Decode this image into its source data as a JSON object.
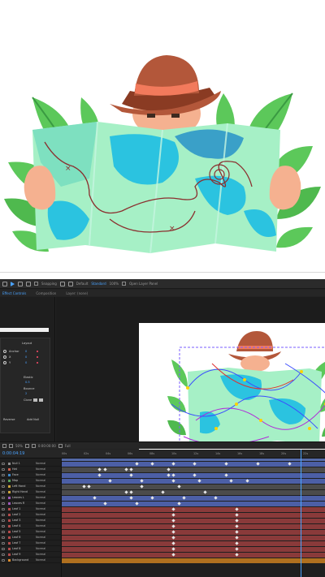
{
  "toolbar": {
    "snapping_label": "Snapping",
    "default_label": "Default",
    "standard_label": "Standard",
    "zoom_label": "100%",
    "open_layer_label": "Open Layer Panel"
  },
  "panels": {
    "project_tab": "Effect Controls",
    "composition_tab": "Composition",
    "layer_tab": "Layer: (none)"
  },
  "left_panel": {
    "section_label": "Layout",
    "params": [
      {
        "label": "Anchor",
        "value": "0"
      },
      {
        "label": "X",
        "value": "0"
      },
      {
        "label": "Y",
        "value": "0"
      },
      {
        "label": "Elastic",
        "value": "0.5"
      },
      {
        "label": "Bounce",
        "value": "2"
      },
      {
        "label": "Clone",
        "value": "1"
      }
    ],
    "button_left": "Reverse",
    "button_right": "Add Null"
  },
  "viewer_bar": {
    "zoom": "50%",
    "time": "0:00:00:00",
    "quality": "Full"
  },
  "timeline": {
    "current_time": "0:00:04:19",
    "ruler_ticks": [
      "00s",
      "02s",
      "04s",
      "06s",
      "08s",
      "10s",
      "12s",
      "14s",
      "16s",
      "18s",
      "20s",
      "22s"
    ],
    "layers": [
      {
        "name": "Null 1",
        "mode": "Normal",
        "color": "#8e8e8e",
        "track_color": "#4c5fa6",
        "keyframes": [
          0.28,
          0.34,
          0.42,
          0.5,
          0.62,
          0.74,
          0.86
        ]
      },
      {
        "name": "Hat",
        "mode": "Normal",
        "color": "#c85b4a",
        "track_color": "#4b4b4b",
        "keyframes": [
          0.14,
          0.16,
          0.24,
          0.26,
          0.4
        ]
      },
      {
        "name": "Face",
        "mode": "Normal",
        "color": "#3b87c9",
        "track_color": "#4c5fa6",
        "keyframes": [
          0.14,
          0.26,
          0.4,
          0.42,
          0.5,
          0.62
        ]
      },
      {
        "name": "Map",
        "mode": "Normal",
        "color": "#56a25a",
        "track_color": "#4c5fa6",
        "keyframes": [
          0.18,
          0.3,
          0.42,
          0.52,
          0.64,
          0.7
        ]
      },
      {
        "name": "Left Hand",
        "mode": "Normal",
        "color": "#c9a23b",
        "track_color": "#4b4b4b",
        "keyframes": [
          0.08,
          0.1,
          0.3,
          0.44
        ]
      },
      {
        "name": "Right Hand",
        "mode": "Normal",
        "color": "#c9a23b",
        "track_color": "#4b4b4b",
        "keyframes": [
          0.24,
          0.26,
          0.38,
          0.54
        ]
      },
      {
        "name": "Leaves L",
        "mode": "Normal",
        "color": "#9b59b6",
        "track_color": "#4c5fa6",
        "keyframes": [
          0.12,
          0.26,
          0.34,
          0.46,
          0.58
        ]
      },
      {
        "name": "Leaves R",
        "mode": "Normal",
        "color": "#9b59b6",
        "track_color": "#4c5fa6",
        "keyframes": [
          0.16,
          0.28,
          0.44
        ]
      },
      {
        "name": "Leaf 1",
        "mode": "Normal",
        "color": "#b24a4a",
        "track_color": "#8a3a3a",
        "keyframes": [
          0.42,
          0.66
        ]
      },
      {
        "name": "Leaf 2",
        "mode": "Normal",
        "color": "#b24a4a",
        "track_color": "#8a3a3a",
        "keyframes": [
          0.42,
          0.66
        ]
      },
      {
        "name": "Leaf 3",
        "mode": "Normal",
        "color": "#b24a4a",
        "track_color": "#8a3a3a",
        "keyframes": [
          0.42,
          0.66
        ]
      },
      {
        "name": "Leaf 4",
        "mode": "Normal",
        "color": "#b24a4a",
        "track_color": "#8a3a3a",
        "keyframes": [
          0.42,
          0.66
        ]
      },
      {
        "name": "Leaf 5",
        "mode": "Normal",
        "color": "#b24a4a",
        "track_color": "#8a3a3a",
        "keyframes": [
          0.42,
          0.66
        ]
      },
      {
        "name": "Leaf 6",
        "mode": "Normal",
        "color": "#b24a4a",
        "track_color": "#8a3a3a",
        "keyframes": [
          0.42,
          0.66
        ]
      },
      {
        "name": "Leaf 7",
        "mode": "Normal",
        "color": "#b24a4a",
        "track_color": "#8a3a3a",
        "keyframes": [
          0.42,
          0.66
        ]
      },
      {
        "name": "Leaf 8",
        "mode": "Normal",
        "color": "#b24a4a",
        "track_color": "#8a3a3a",
        "keyframes": [
          0.42,
          0.66
        ]
      },
      {
        "name": "Leaf 9",
        "mode": "Normal",
        "color": "#b24a4a",
        "track_color": "#8a3a3a",
        "keyframes": [
          0.42,
          0.66
        ]
      },
      {
        "name": "Background",
        "mode": "Normal",
        "color": "#d98a2b",
        "track_color": "#b0701f",
        "keyframes": []
      }
    ]
  },
  "colors": {
    "accent": "#4aa3ff",
    "map_light": "#a6f0c6",
    "map_water": "#2bc3e0",
    "hat": "#b3573a",
    "hat_band": "#f27a5c",
    "leaf": "#5cc85a",
    "skin": "#f5b190"
  }
}
